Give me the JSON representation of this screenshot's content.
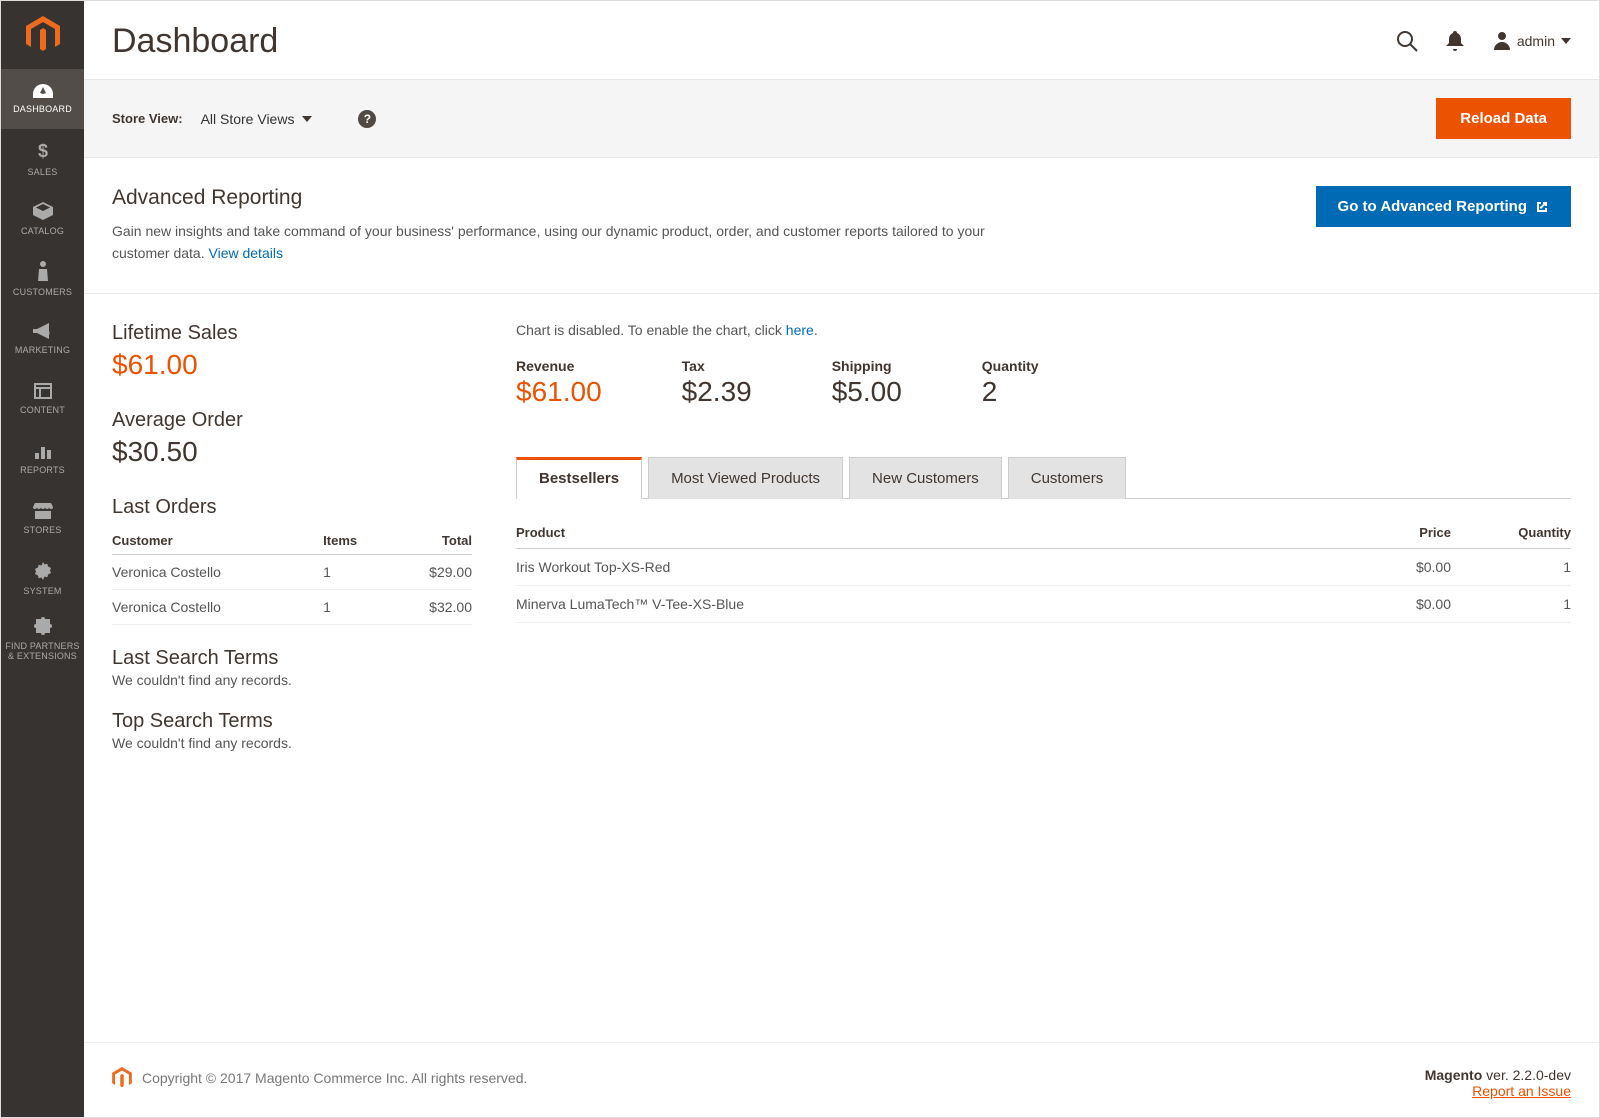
{
  "header": {
    "title": "Dashboard",
    "admin_label": "admin"
  },
  "sidebar": {
    "items": [
      {
        "label": "DASHBOARD"
      },
      {
        "label": "SALES"
      },
      {
        "label": "CATALOG"
      },
      {
        "label": "CUSTOMERS"
      },
      {
        "label": "MARKETING"
      },
      {
        "label": "CONTENT"
      },
      {
        "label": "REPORTS"
      },
      {
        "label": "STORES"
      },
      {
        "label": "SYSTEM"
      },
      {
        "label": "FIND PARTNERS & EXTENSIONS"
      }
    ]
  },
  "toolbar": {
    "scope_label": "Store View:",
    "scope_value": "All Store Views",
    "reload_label": "Reload Data"
  },
  "advanced_reporting": {
    "title": "Advanced Reporting",
    "desc": "Gain new insights and take command of your business' performance, using our dynamic product, order, and customer reports tailored to your customer data.",
    "view_details": "View details",
    "button": "Go to Advanced Reporting"
  },
  "stats": {
    "lifetime_label": "Lifetime Sales",
    "lifetime_value": "$61.00",
    "avg_label": "Average Order",
    "avg_value": "$30.50"
  },
  "last_orders": {
    "title": "Last Orders",
    "headers": {
      "customer": "Customer",
      "items": "Items",
      "total": "Total"
    },
    "rows": [
      {
        "customer": "Veronica Costello",
        "items": "1",
        "total": "$29.00"
      },
      {
        "customer": "Veronica Costello",
        "items": "1",
        "total": "$32.00"
      }
    ]
  },
  "last_search": {
    "title": "Last Search Terms",
    "empty": "We couldn't find any records."
  },
  "top_search": {
    "title": "Top Search Terms",
    "empty": "We couldn't find any records."
  },
  "chart_note": {
    "prefix": "Chart is disabled. To enable the chart, click ",
    "link": "here",
    "suffix": "."
  },
  "metrics": {
    "revenue": {
      "label": "Revenue",
      "value": "$61.00"
    },
    "tax": {
      "label": "Tax",
      "value": "$2.39"
    },
    "shipping": {
      "label": "Shipping",
      "value": "$5.00"
    },
    "quantity": {
      "label": "Quantity",
      "value": "2"
    }
  },
  "tabs": {
    "bestsellers": "Bestsellers",
    "most_viewed": "Most Viewed Products",
    "new_customers": "New Customers",
    "customers": "Customers"
  },
  "bestsellers": {
    "headers": {
      "product": "Product",
      "price": "Price",
      "quantity": "Quantity"
    },
    "rows": [
      {
        "product": "Iris Workout Top-XS-Red",
        "price": "$0.00",
        "qty": "1"
      },
      {
        "product": "Minerva LumaTech™ V-Tee-XS-Blue",
        "price": "$0.00",
        "qty": "1"
      }
    ]
  },
  "footer": {
    "copyright": "Copyright © 2017 Magento Commerce Inc. All rights reserved.",
    "version_prefix": "Magento",
    "version_suffix": " ver. 2.2.0-dev",
    "report": "Report an Issue"
  }
}
